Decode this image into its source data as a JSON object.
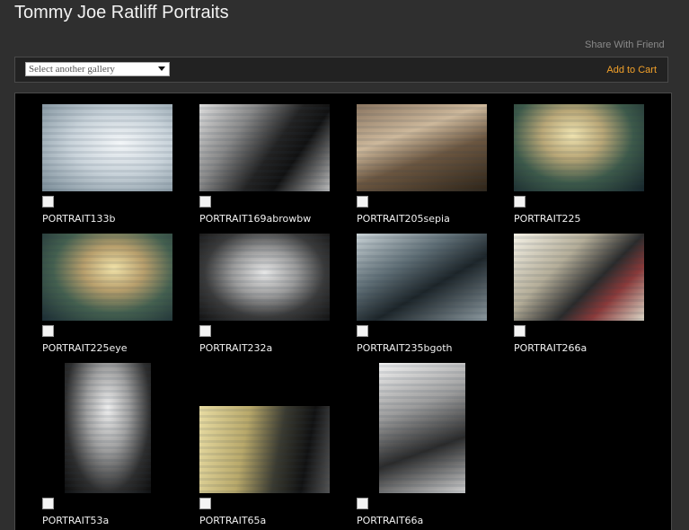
{
  "header": {
    "title": "Tommy Joe Ratliff Portraits",
    "share_link": "Share With Friend"
  },
  "toolbar": {
    "gallery_select_placeholder": "Select another gallery",
    "add_to_cart": "Add to Cart"
  },
  "colors": {
    "background": "#2f2f2f",
    "grid_background": "#000000",
    "accent": "#f2a12a"
  },
  "photos": [
    {
      "name": "PORTRAIT133b",
      "checked": false
    },
    {
      "name": "PORTRAIT169abrowbw",
      "checked": false
    },
    {
      "name": "PORTRAIT205sepia",
      "checked": false
    },
    {
      "name": "PORTRAIT225",
      "checked": false
    },
    {
      "name": "PORTRAIT225eye",
      "checked": false
    },
    {
      "name": "PORTRAIT232a",
      "checked": false
    },
    {
      "name": "PORTRAIT235bgoth",
      "checked": false
    },
    {
      "name": "PORTRAIT266a",
      "checked": false
    },
    {
      "name": "PORTRAIT53a",
      "checked": false
    },
    {
      "name": "PORTRAIT65a",
      "checked": false
    },
    {
      "name": "PORTRAIT66a",
      "checked": false
    }
  ]
}
